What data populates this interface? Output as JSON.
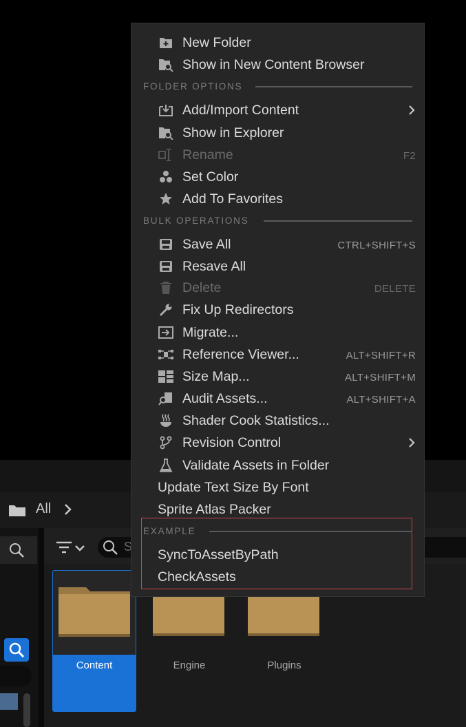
{
  "menu": {
    "items_top": [
      {
        "label": "New Folder",
        "icon": "new-folder-icon"
      },
      {
        "label": "Show in New Content Browser",
        "icon": "show-in-content-browser-icon"
      }
    ],
    "folder_options": {
      "header": "FOLDER OPTIONS",
      "items": [
        {
          "label": "Add/Import Content",
          "icon": "import-icon",
          "submenu": true
        },
        {
          "label": "Show in Explorer",
          "icon": "explorer-icon"
        },
        {
          "label": "Rename",
          "icon": "rename-icon",
          "shortcut": "F2",
          "disabled": true
        },
        {
          "label": "Set Color",
          "icon": "color-icon"
        },
        {
          "label": "Add To Favorites",
          "icon": "star-icon"
        }
      ]
    },
    "bulk_operations": {
      "header": "BULK OPERATIONS",
      "items": [
        {
          "label": "Save All",
          "icon": "save-icon",
          "shortcut": "CTRL+SHIFT+S"
        },
        {
          "label": "Resave All",
          "icon": "resave-icon"
        },
        {
          "label": "Delete",
          "icon": "trash-icon",
          "shortcut": "DELETE",
          "disabled": true
        },
        {
          "label": "Fix Up Redirectors",
          "icon": "wrench-icon"
        },
        {
          "label": "Migrate...",
          "icon": "migrate-icon"
        },
        {
          "label": "Reference Viewer...",
          "icon": "reference-viewer-icon",
          "shortcut": "ALT+SHIFT+R"
        },
        {
          "label": "Size Map...",
          "icon": "size-map-icon",
          "shortcut": "ALT+SHIFT+M"
        },
        {
          "label": "Audit Assets...",
          "icon": "audit-icon",
          "shortcut": "ALT+SHIFT+A"
        },
        {
          "label": "Shader Cook Statistics...",
          "icon": "shader-cook-icon"
        },
        {
          "label": "Revision Control",
          "icon": "revision-control-icon",
          "submenu": true
        },
        {
          "label": "Validate Assets in Folder",
          "icon": "flask-icon"
        },
        {
          "label": "Update Text Size By Font"
        },
        {
          "label": "Sprite Atlas Packer"
        }
      ]
    },
    "example": {
      "header": "EXAMPLE",
      "items": [
        {
          "label": "SyncToAssetByPath"
        },
        {
          "label": "CheckAssets"
        }
      ]
    }
  },
  "content_browser": {
    "path_label": "All",
    "search_placeholder": "S",
    "tiles": [
      {
        "label": "Content",
        "selected": true
      },
      {
        "label": "Engine"
      },
      {
        "label": "Plugins"
      }
    ]
  },
  "colors": {
    "accent": "#1a72d6",
    "highlight_box": "#d04545",
    "folder": "#b99256"
  }
}
